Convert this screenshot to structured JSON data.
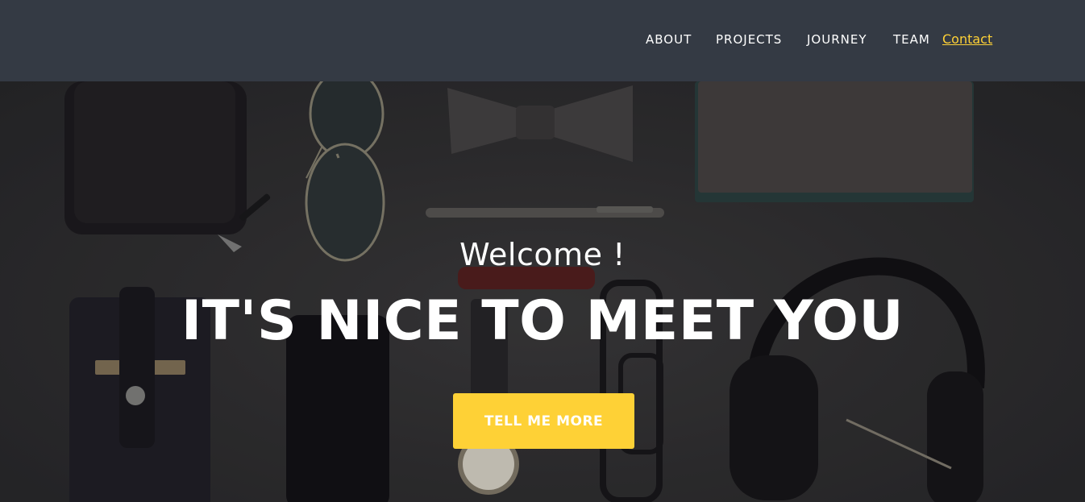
{
  "nav": {
    "items": [
      {
        "label": "ABOUT"
      },
      {
        "label": "PROJECTS"
      },
      {
        "label": "JOURNEY"
      },
      {
        "label": "TEAM"
      },
      {
        "label": "Contact"
      }
    ]
  },
  "hero": {
    "subheading": "Welcome !",
    "heading": "IT'S NICE TO MEET YOU",
    "cta_label": "TELL ME MORE"
  },
  "colors": {
    "navbar_bg": "#343a44",
    "accent": "#fed136",
    "nav_text": "#ffffff"
  }
}
